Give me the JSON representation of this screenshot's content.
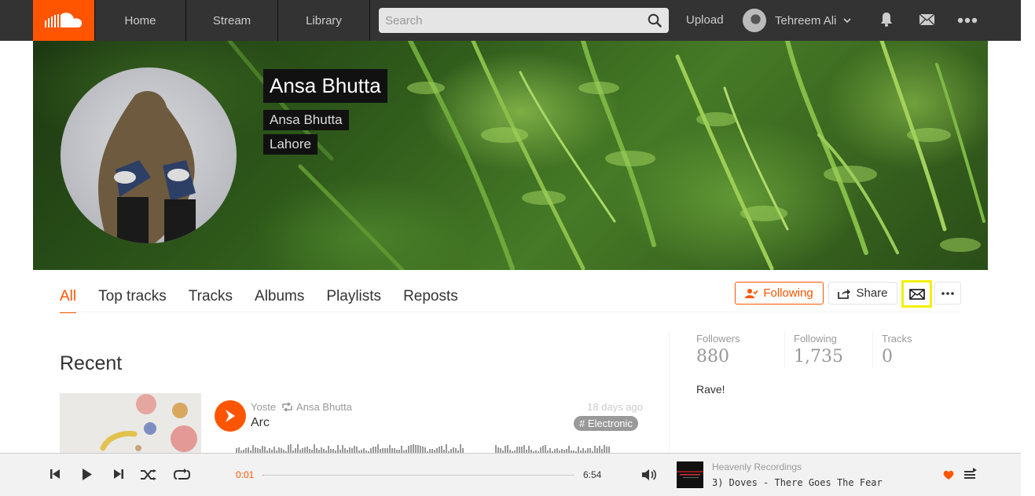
{
  "nav": {
    "tabs": [
      "Home",
      "Stream",
      "Library"
    ],
    "search_placeholder": "Search",
    "upload_label": "Upload",
    "user_name": "Tehreem Ali"
  },
  "profile": {
    "display_name": "Ansa Bhutta",
    "full_name": "Ansa Bhutta",
    "city": "Lahore"
  },
  "profile_tabs": [
    "All",
    "Top tracks",
    "Tracks",
    "Albums",
    "Playlists",
    "Reposts"
  ],
  "active_tab": "All",
  "actions": {
    "following_label": "Following",
    "share_label": "Share"
  },
  "recent": {
    "section_title": "Recent",
    "track": {
      "uploader": "Yoste",
      "reposted_by": "Ansa Bhutta",
      "title": "Arc",
      "posted": "18 days ago",
      "tag": "# Electronic"
    }
  },
  "stats": {
    "followers_label": "Followers",
    "followers": "880",
    "following_label": "Following",
    "following": "1,735",
    "tracks_label": "Tracks",
    "tracks": "0"
  },
  "bio": "Rave!",
  "player": {
    "elapsed": "0:01",
    "duration": "6:54",
    "progress_fraction": 0.002,
    "label": "Heavenly Recordings",
    "now_playing": "3) Doves - There Goes The Fear"
  },
  "colors": {
    "accent": "#ff5500",
    "topbar": "#333333",
    "highlight_outline": "#f2f00a"
  },
  "icons": [
    "logo-icon",
    "search-icon",
    "chevron-down-icon",
    "bell-icon",
    "mail-icon",
    "more-icon",
    "following-person-icon",
    "share-icon",
    "play-icon",
    "repost-icon",
    "previous-icon",
    "next-icon",
    "shuffle-icon",
    "repeat-icon",
    "volume-icon",
    "like-heart-icon",
    "queue-icon"
  ]
}
